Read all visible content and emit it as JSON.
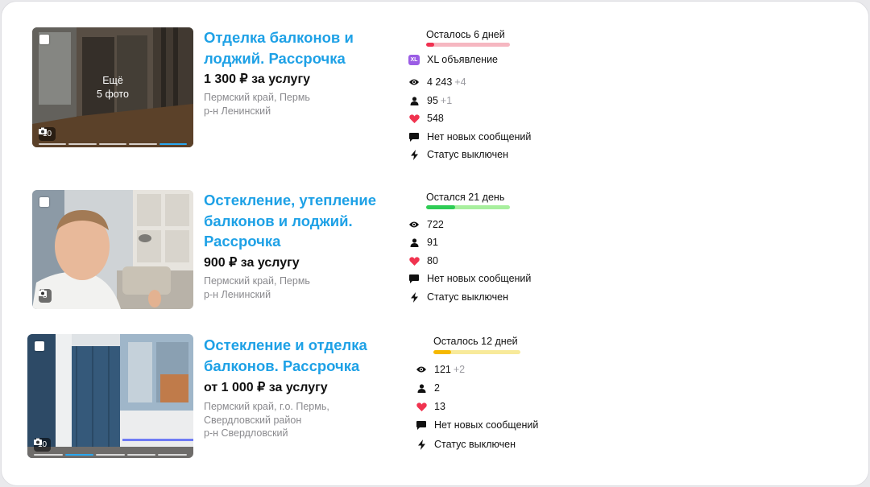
{
  "listings": [
    {
      "title": "Отделка балконов и лоджий. Рассрочка",
      "title_lines": [
        "Отделка балконов и",
        "лоджий. Рассрочка"
      ],
      "price": "1 300 ₽ за услугу",
      "address_lines": [
        "Пермский край, Пермь",
        "р-н Ленинский"
      ],
      "photo_count": "10",
      "more_photos_lines": [
        "Ещё",
        "5 фото"
      ],
      "remaining": "Осталось 6 дней",
      "remaining_progress": 0.1,
      "bar_color": "#f03050",
      "bar_track_color": "#f6b7c1",
      "promo": "XL объявление",
      "promo_badge": "XL",
      "views": "4 243",
      "views_delta": "+4",
      "contacts": "95",
      "contacts_delta": "+1",
      "favorites": "548",
      "messages": "Нет новых сообщений",
      "status": "Статус выключен"
    },
    {
      "title": "Остекление, утепление балконов и лоджий. Рассрочка",
      "title_lines": [
        "Остекление, утепление",
        "балконов и лоджий.",
        "Рассрочка"
      ],
      "price": "900 ₽ за услугу",
      "address_lines": [
        "Пермский край, Пермь",
        "р-н Ленинский"
      ],
      "photo_count": "8",
      "remaining": "Остался 21 день",
      "remaining_progress": 0.35,
      "bar_color": "#2ecc55",
      "bar_track_color": "#a8ef9e",
      "views": "722",
      "contacts": "91",
      "favorites": "80",
      "messages": "Нет новых сообщений",
      "status": "Статус выключен"
    },
    {
      "title": "Остекление и отделка балконов. Рассрочка",
      "title_lines": [
        "Остекление и отделка",
        "балконов. Рассрочка"
      ],
      "price": "от 1 000 ₽ за услугу",
      "address_lines": [
        "Пермский край, г.о. Пермь,",
        "Свердловский район",
        "р-н Свердловский"
      ],
      "photo_count": "10",
      "remaining": "Осталось 12 дней",
      "remaining_progress": 0.2,
      "bar_color": "#f5b800",
      "bar_track_color": "#f8ea9a",
      "views": "121",
      "views_delta": "+2",
      "contacts": "2",
      "favorites": "13",
      "messages": "Нет новых сообщений",
      "status": "Статус выключен"
    }
  ],
  "icons": {
    "views": "eye-icon",
    "contacts": "person-icon",
    "favorites": "heart-icon",
    "messages": "chat-bubble-icon",
    "status": "lightning-icon",
    "photos": "camera-icon"
  },
  "colors": {
    "title": "#1ea1e6",
    "heart": "#f0334f",
    "xl_badge": "#9b5de5"
  }
}
